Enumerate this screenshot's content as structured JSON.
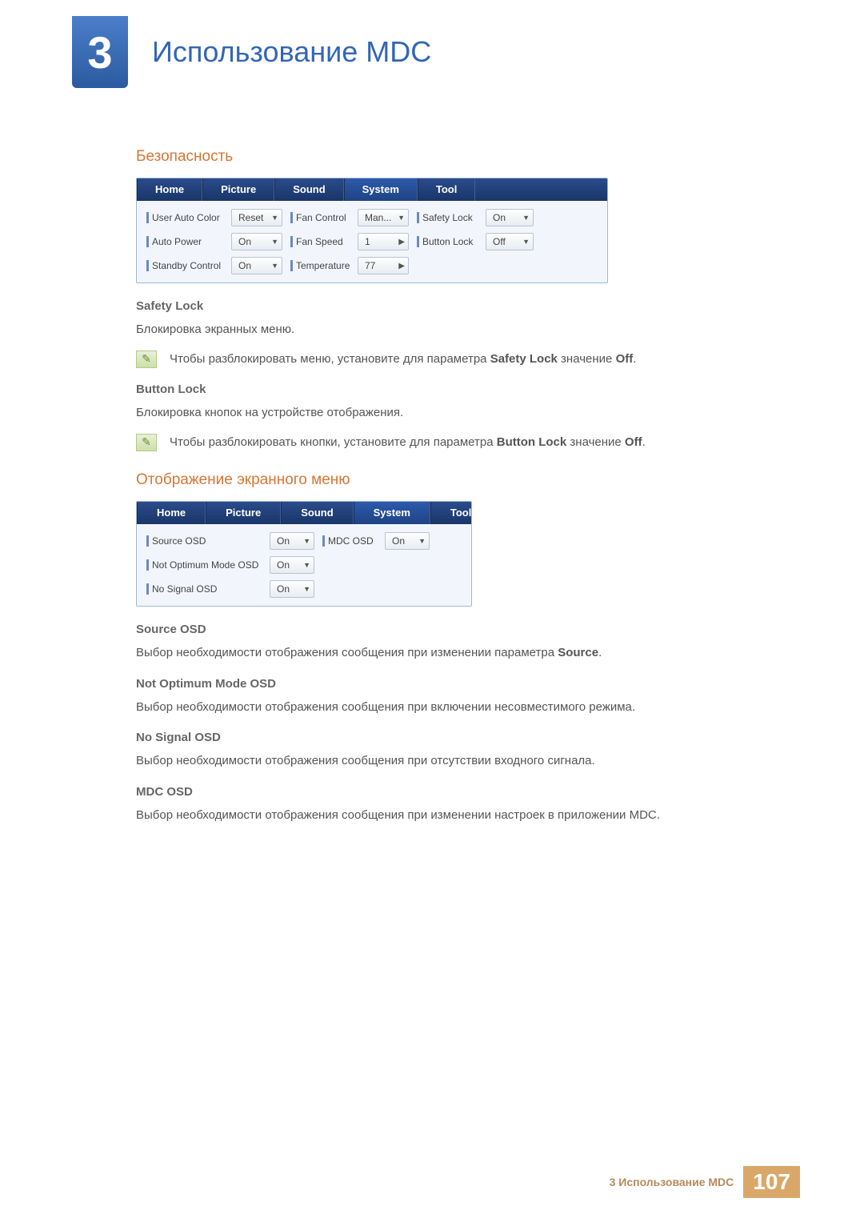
{
  "chapter": {
    "number": "3",
    "title": "Использование MDC"
  },
  "section1": {
    "heading": "Безопасность",
    "tabs": [
      "Home",
      "Picture",
      "Sound",
      "System",
      "Tool"
    ],
    "active_tab_index": 3,
    "col1": [
      {
        "label": "User Auto Color",
        "value": "Reset",
        "arrow": "▼"
      },
      {
        "label": "Auto Power",
        "value": "On",
        "arrow": "▼"
      },
      {
        "label": "Standby Control",
        "value": "On",
        "arrow": "▼"
      }
    ],
    "col2": [
      {
        "label": "Fan Control",
        "value": "Man...",
        "arrow": "▼"
      },
      {
        "label": "Fan Speed",
        "value": "1",
        "arrow": "▶"
      },
      {
        "label": "Temperature",
        "value": "77",
        "arrow": "▶"
      }
    ],
    "col3": [
      {
        "label": "Safety Lock",
        "value": "On",
        "arrow": "▼"
      },
      {
        "label": "Button Lock",
        "value": "Off",
        "arrow": "▼"
      }
    ]
  },
  "safety_lock": {
    "heading": "Safety Lock",
    "text": "Блокировка экранных меню.",
    "note_pre": "Чтобы разблокировать меню, установите для параметра ",
    "note_bold1": "Safety Lock",
    "note_mid": " значение ",
    "note_bold2": "Off",
    "note_post": "."
  },
  "button_lock": {
    "heading": "Button Lock",
    "text": "Блокировка кнопок на устройстве отображения.",
    "note_pre": "Чтобы разблокировать кнопки, установите для параметра ",
    "note_bold1": "Button Lock",
    "note_mid": " значение ",
    "note_bold2": "Off",
    "note_post": "."
  },
  "section2": {
    "heading": "Отображение экранного меню",
    "tabs": [
      "Home",
      "Picture",
      "Sound",
      "System",
      "Tool"
    ],
    "active_tab_index": 3,
    "col1": [
      {
        "label": "Source OSD",
        "value": "On",
        "arrow": "▼"
      },
      {
        "label": "Not Optimum Mode OSD",
        "value": "On",
        "arrow": "▼"
      },
      {
        "label": "No Signal OSD",
        "value": "On",
        "arrow": "▼"
      }
    ],
    "col2": [
      {
        "label": "MDC OSD",
        "value": "On",
        "arrow": "▼"
      }
    ]
  },
  "source_osd": {
    "heading": "Source OSD",
    "text_pre": "Выбор необходимости отображения сообщения при изменении параметра ",
    "text_bold": "Source",
    "text_post": "."
  },
  "not_optimum": {
    "heading": "Not Optimum Mode OSD",
    "text": "Выбор необходимости отображения сообщения при включении несовместимого режима."
  },
  "no_signal": {
    "heading": "No Signal OSD",
    "text": "Выбор необходимости отображения сообщения при отсутствии входного сигнала."
  },
  "mdc_osd": {
    "heading": "MDC OSD",
    "text": "Выбор необходимости отображения сообщения при изменении настроек в приложении MDC."
  },
  "footer": {
    "text": "3 Использование MDC",
    "page": "107"
  }
}
